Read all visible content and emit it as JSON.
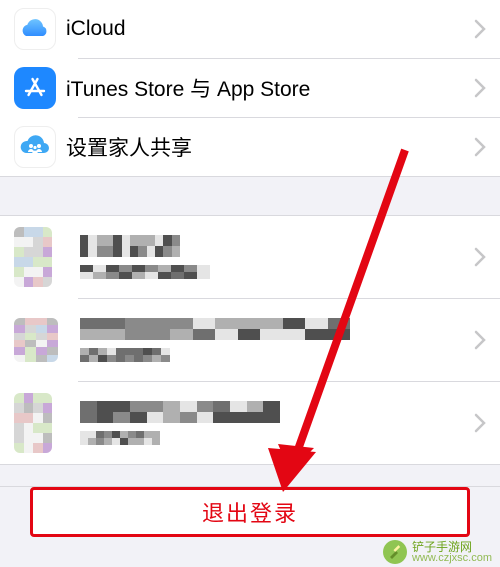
{
  "menu_group": {
    "items": [
      {
        "icon": "icloud-icon",
        "label": "iCloud"
      },
      {
        "icon": "appstore-icon",
        "label": "iTunes Store 与 App Store"
      },
      {
        "icon": "family-icon",
        "label": "设置家人共享"
      }
    ]
  },
  "devices_group": {
    "items": [
      {
        "name_obscured": true,
        "subtitle_obscured": true
      },
      {
        "name_obscured": true,
        "subtitle_obscured": true
      },
      {
        "name_obscured": true,
        "subtitle_obscured": true
      }
    ]
  },
  "signout": {
    "label": "退出登录"
  },
  "watermark": {
    "brand": "铲子手游网",
    "site": "www.czjxsc.com"
  },
  "colors": {
    "annotation_red": "#e30613",
    "chevron_gray": "#c6c6c8"
  }
}
